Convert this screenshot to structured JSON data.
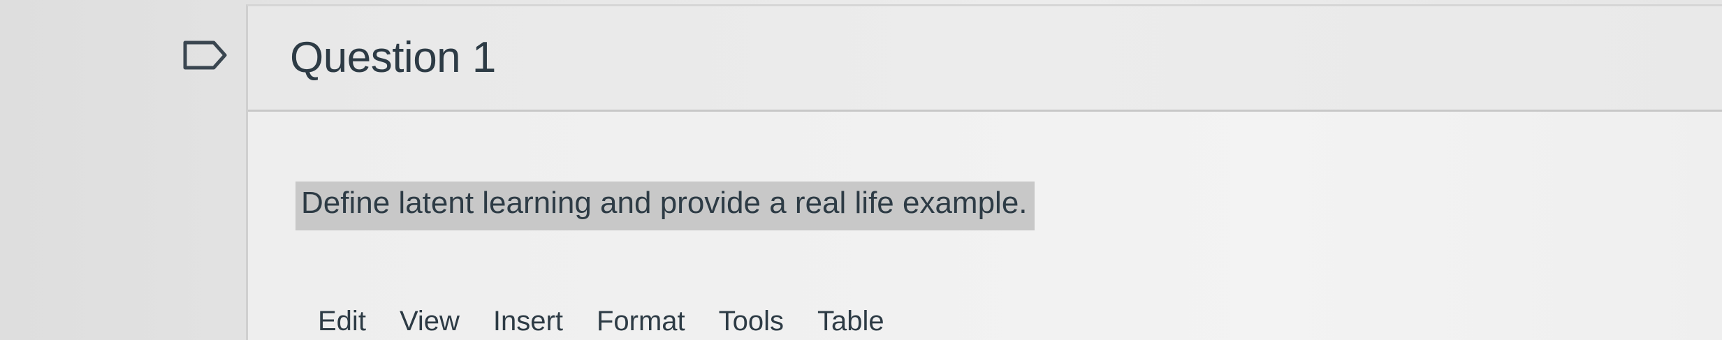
{
  "question": {
    "title": "Question 1",
    "flag_icon": "flag-outline-icon",
    "prompt": "Define latent learning and provide a real life example."
  },
  "editor": {
    "menu": [
      "Edit",
      "View",
      "Insert",
      "Format",
      "Tools",
      "Table"
    ]
  }
}
